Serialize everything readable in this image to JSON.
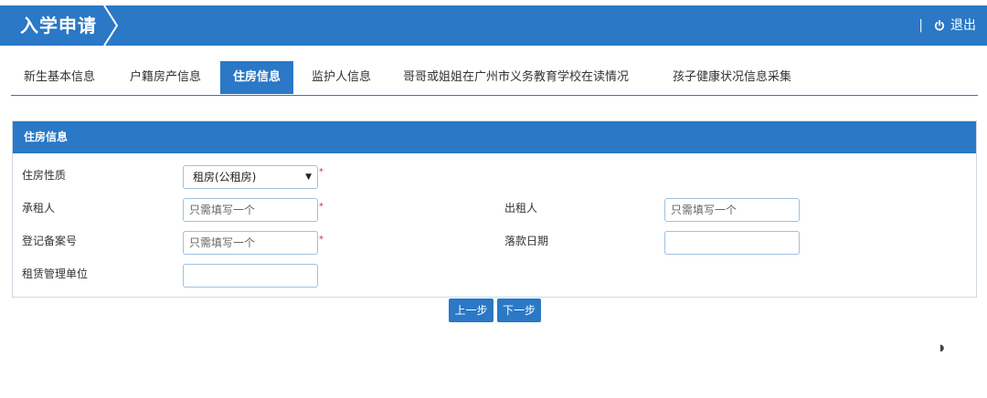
{
  "header": {
    "title": "入学申请",
    "separator": "|",
    "logout_label": "退出"
  },
  "tabs": [
    {
      "label": "新生基本信息"
    },
    {
      "label": "户籍房产信息"
    },
    {
      "label": "住房信息"
    },
    {
      "label": "监护人信息"
    },
    {
      "label": "哥哥或姐姐在广州市义务教育学校在读情况"
    },
    {
      "label": "孩子健康状况信息采集"
    }
  ],
  "panel": {
    "title": "住房信息",
    "housing_type_label": "住房性质",
    "housing_type_value": "租房(公租房)",
    "tenant_label": "承租人",
    "tenant_placeholder": "只需填写一个",
    "landlord_label": "出租人",
    "landlord_placeholder": "只需填写一个",
    "registration_label": "登记备案号",
    "registration_placeholder": "只需填写一个",
    "settle_date_label": "落款日期",
    "settle_date_value": "",
    "management_unit_label": "租赁管理单位",
    "management_unit_value": "",
    "required_mark": "*"
  },
  "actions": {
    "prev_label": "上一步",
    "next_label": "下一步"
  },
  "colors": {
    "primary": "#2a78c6",
    "required": "#e03030"
  }
}
